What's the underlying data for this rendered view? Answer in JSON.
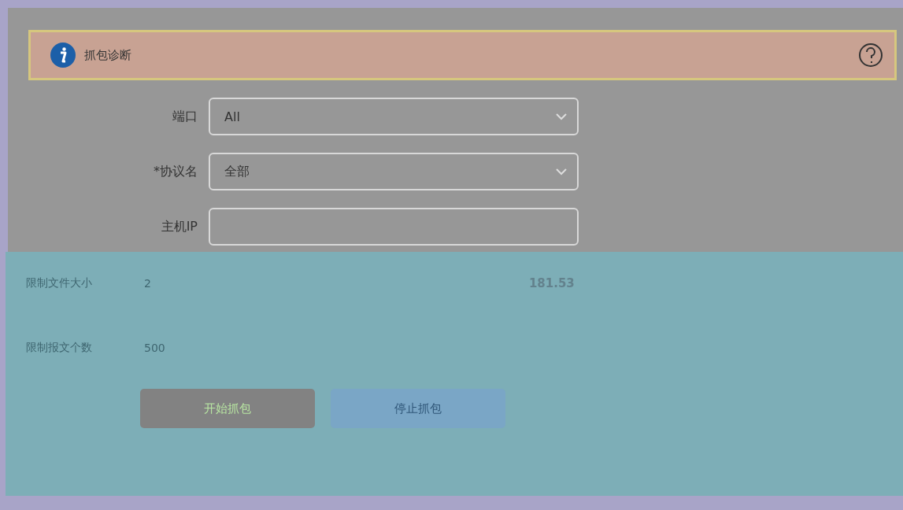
{
  "header": {
    "title": "抓包诊断"
  },
  "fields": [
    {
      "label": "端口",
      "value": "All",
      "kind": "select"
    },
    {
      "label": "*协议名",
      "value": "全部",
      "kind": "select"
    },
    {
      "label": "主机IP",
      "kind": "input"
    }
  ],
  "limits": [
    {
      "label": "限制文件大小",
      "value": "2"
    },
    {
      "label": "限制报文个数",
      "value": "500"
    }
  ],
  "reading": "181.53",
  "buttons": [
    {
      "label": "开始抓包",
      "disabled": false
    },
    {
      "label": "停止抓包",
      "disabled": true
    }
  ]
}
